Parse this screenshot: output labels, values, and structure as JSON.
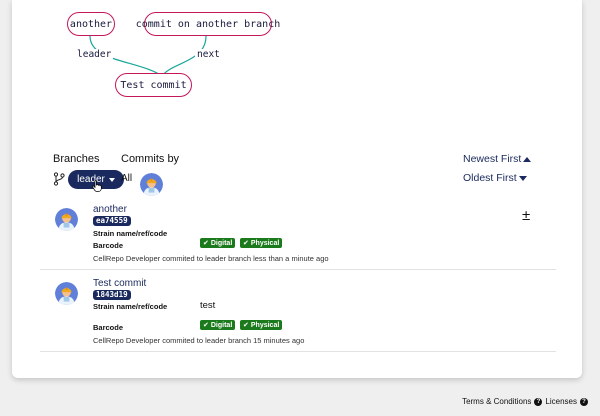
{
  "graph": {
    "nodes": {
      "another": "another",
      "commit_other": "commit on another branch",
      "test_commit": "Test commit"
    },
    "edges": {
      "leader": "leader",
      "next": "next"
    },
    "colors": {
      "node_border": "#c2185b",
      "edge": "#1aa69a"
    }
  },
  "filters": {
    "branches_label": "Branches",
    "branch_selected": "leader",
    "commits_by_label": "Commits by",
    "all_label": "All",
    "sort_newest": "Newest First",
    "sort_oldest": "Oldest First"
  },
  "commits": [
    {
      "title": "another",
      "hash": "ea74559",
      "strain_label": "Strain name/ref/code",
      "strain_value": "",
      "barcode_label": "Barcode",
      "tags": [
        "Digital",
        "Physical"
      ],
      "meta": "CellRepo Developer commited to leader branch less than a minute ago"
    },
    {
      "title": "Test commit",
      "hash": "1843d19",
      "strain_label": "Strain name/ref/code",
      "strain_value": "test",
      "barcode_label": "Barcode",
      "tags": [
        "Digital",
        "Physical"
      ],
      "meta": "CellRepo Developer commited to leader branch 15 minutes ago"
    }
  ],
  "actions": {
    "expand_symbol": "±"
  },
  "footer": {
    "terms": "Terms & Conditions",
    "licenses": "Licenses",
    "help_glyph": "?"
  },
  "colors": {
    "brand": "#1b2a5e",
    "tag_green": "#1b7a1b",
    "background": "#efefef"
  }
}
